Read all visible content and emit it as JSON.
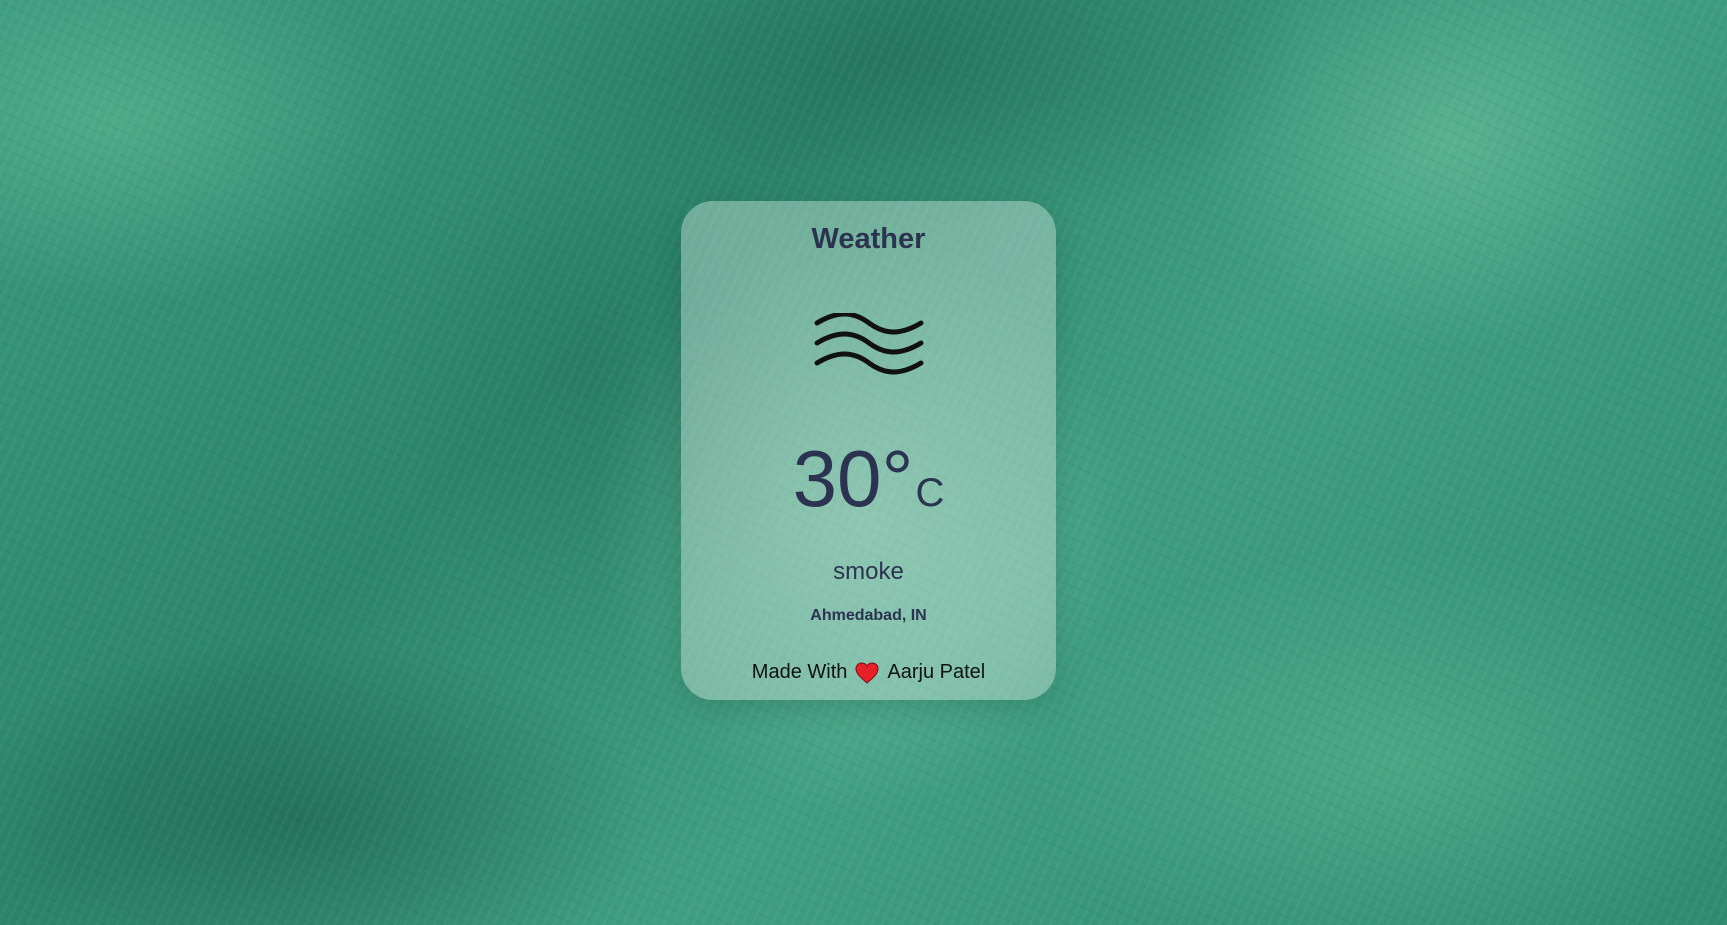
{
  "card": {
    "title": "Weather",
    "weather_icon": "wind-waves-icon",
    "temperature": "30°",
    "temperature_unit": "C",
    "condition": "smoke",
    "location": "Ahmedabad, IN"
  },
  "footer": {
    "made_with": "Made With",
    "heart_icon": "heart-icon",
    "author": "Aarju Patel"
  },
  "colors": {
    "text_primary": "#2c3350",
    "heart": "#e8202a",
    "background": "#2f8f74"
  }
}
